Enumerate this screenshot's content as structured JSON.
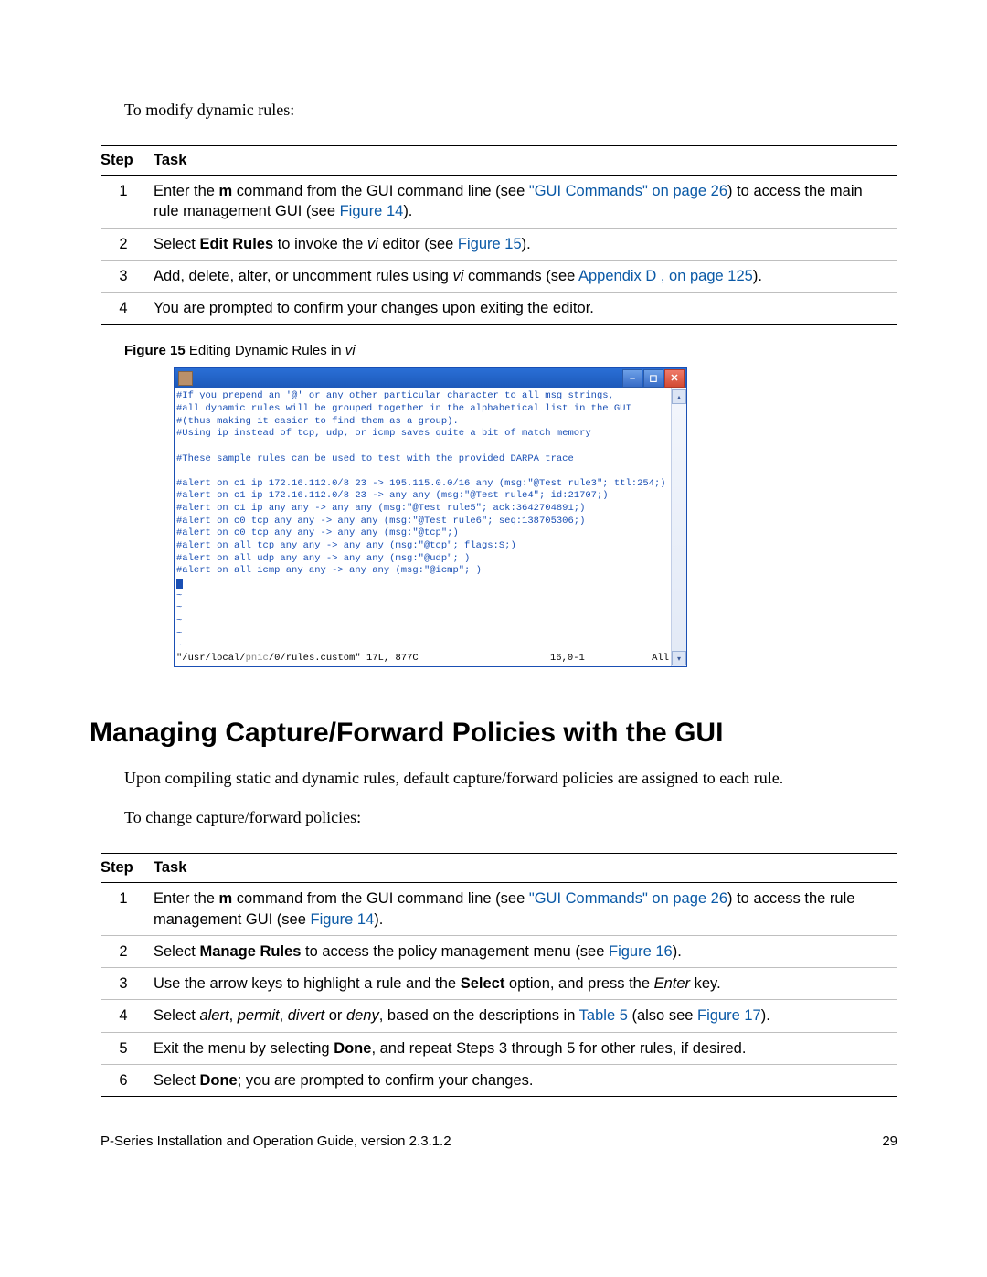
{
  "intro1": "To modify dynamic rules:",
  "table1": {
    "h_step": "Step",
    "h_task": "Task",
    "rows": [
      {
        "n": "1",
        "a": "Enter the ",
        "b": "m",
        "c": " command from the GUI command line (see ",
        "l1": "\"GUI Commands\" on page 26",
        "d": ") to access the main rule management GUI (see ",
        "l2": "Figure 14",
        "e": ")."
      },
      {
        "n": "2",
        "a": "Select ",
        "b": "Edit Rules",
        "c": " to invoke the ",
        "i": "vi",
        "d": " editor (see ",
        "l1": "Figure 15",
        "e": ")."
      },
      {
        "n": "3",
        "a": "Add, delete, alter, or uncomment rules using ",
        "i": "vi",
        "b": " commands (see ",
        "l1": "Appendix D , on page 125",
        "c": ")."
      },
      {
        "n": "4",
        "a": "You are prompted to confirm your changes upon exiting the editor."
      }
    ]
  },
  "fig15": {
    "label": "Figure 15",
    "rest": "   Editing Dynamic Rules in ",
    "ital": "vi"
  },
  "vi": {
    "lines": [
      "#If you prepend an '@' or any other particular character to all msg strings,",
      "#all dynamic rules will be grouped together in the alphabetical list in the GUI",
      "#(thus making it easier to find them as a group).",
      "#Using ip instead of tcp, udp, or icmp saves quite a bit of match memory",
      "",
      "#These sample rules can be used to test with the provided DARPA trace",
      "",
      "#alert on c1 ip 172.16.112.0/8 23 -> 195.115.0.0/16 any (msg:\"@Test rule3\"; ttl:254;)",
      "#alert on c1 ip 172.16.112.0/8 23 -> any any (msg:\"@Test rule4\"; id:21707;)",
      "#alert on c1 ip any any -> any any (msg:\"@Test rule5\"; ack:3642704891;)",
      "#alert on c0 tcp any any -> any any (msg:\"@Test rule6\"; seq:138705306;)",
      "#alert on c0 tcp any any -> any any (msg:\"@tcp\";)",
      "#alert on all tcp any any -> any any (msg:\"@tcp\"; flags:S;)",
      "#alert on all udp any any -> any any (msg:\"@udp\"; )",
      "#alert on all icmp any any -> any any (msg:\"@icmp\"; )"
    ],
    "status_path_pre": "\"/usr/local/",
    "status_path_faded": "pnic",
    "status_path_post": "/0/rules.custom\" 17L, 877C",
    "status_pos": "16,0-1",
    "status_pct": "All"
  },
  "h1": "Managing Capture/Forward Policies with the GUI",
  "para2": "Upon compiling static and dynamic rules, default capture/forward policies are assigned to each rule.",
  "intro2": "To change capture/forward policies:",
  "table2": {
    "h_step": "Step",
    "h_task": "Task",
    "rows": [
      {
        "n": "1",
        "a": "Enter the ",
        "b": "m",
        "c": " command from the GUI command line (see ",
        "l1": "\"GUI Commands\" on page 26",
        "d": ") to access the rule management GUI (see ",
        "l2": "Figure 14",
        "e": ")."
      },
      {
        "n": "2",
        "a": "Select ",
        "b": "Manage Rules",
        "c": " to access the policy management menu (see ",
        "l1": "Figure 16",
        "d": ")."
      },
      {
        "n": "3",
        "a": "Use the arrow keys to highlight a rule and the ",
        "b": "Select",
        "c": " option, and press the ",
        "i": "Enter",
        "d": " key."
      },
      {
        "n": "4",
        "a": "Select ",
        "i1": "alert",
        "c1": ", ",
        "i2": "permit",
        "c2": ", ",
        "i3": "divert",
        "c3": " or ",
        "i4": "deny",
        "c4": ", based on the descriptions in ",
        "l1": "Table 5",
        "c5": " (also see ",
        "l2": "Figure 17",
        "c6": ")."
      },
      {
        "n": "5",
        "a": "Exit the menu by selecting ",
        "b": "Done",
        "c": ", and repeat Steps 3 through 5 for other rules, if desired."
      },
      {
        "n": "6",
        "a": "Select ",
        "b": "Done",
        "c": "; you are prompted to confirm your changes."
      }
    ]
  },
  "footer_left": "P-Series Installation and Operation Guide, version 2.3.1.2",
  "footer_right": "29"
}
